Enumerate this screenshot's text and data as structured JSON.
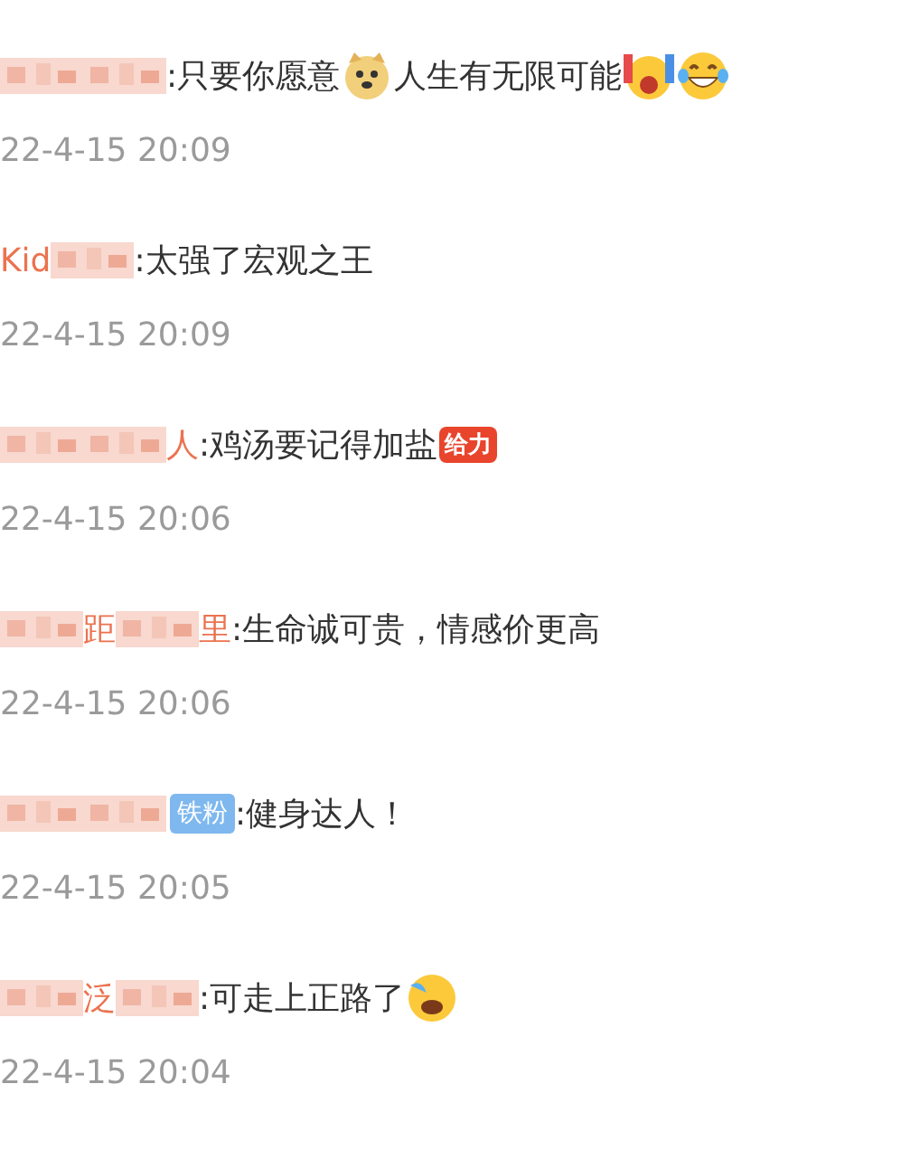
{
  "comments": [
    {
      "name": [
        {
          "kind": "blur"
        },
        {
          "kind": "blur"
        }
      ],
      "body": [
        {
          "kind": "text",
          "text": ":只要你愿意"
        },
        {
          "kind": "doge"
        },
        {
          "kind": "text",
          "text": "人生有无限可能"
        },
        {
          "kind": "cheer"
        },
        {
          "kind": "laugh"
        }
      ],
      "time": "22-4-15 20:09"
    },
    {
      "name": [
        {
          "kind": "text",
          "text": "Kid"
        },
        {
          "kind": "blur"
        }
      ],
      "body": [
        {
          "kind": "text",
          "text": ":太强了宏观之王"
        }
      ],
      "time": "22-4-15 20:09"
    },
    {
      "name": [
        {
          "kind": "blur"
        },
        {
          "kind": "blur"
        },
        {
          "kind": "text",
          "text": "人"
        }
      ],
      "body": [
        {
          "kind": "text",
          "text": ":鸡汤要记得加盐"
        },
        {
          "kind": "sticker",
          "label": "给力"
        }
      ],
      "time": "22-4-15 20:06"
    },
    {
      "name": [
        {
          "kind": "blur"
        },
        {
          "kind": "text",
          "text": "距"
        },
        {
          "kind": "blur"
        },
        {
          "kind": "text",
          "text": "里"
        }
      ],
      "body": [
        {
          "kind": "text",
          "text": ":生命诚可贵，情感价更高"
        }
      ],
      "time": "22-4-15 20:06"
    },
    {
      "name": [
        {
          "kind": "blur"
        },
        {
          "kind": "blur"
        },
        {
          "kind": "badge",
          "text": "铁粉"
        }
      ],
      "body": [
        {
          "kind": "text",
          "text": ":健身达人！"
        }
      ],
      "time": "22-4-15 20:05"
    },
    {
      "name": [
        {
          "kind": "blur"
        },
        {
          "kind": "text",
          "text": "泛"
        },
        {
          "kind": "blur"
        }
      ],
      "body": [
        {
          "kind": "text",
          "text": ":可走上正路了"
        },
        {
          "kind": "sob"
        }
      ],
      "time": "22-4-15 20:04"
    }
  ]
}
